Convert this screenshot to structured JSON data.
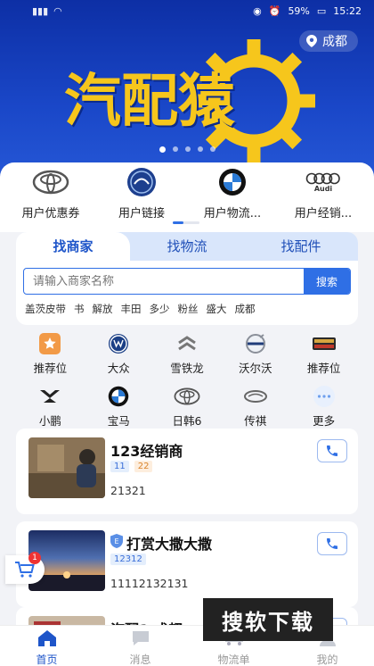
{
  "status_bar": {
    "time": "15:22",
    "battery": "59%"
  },
  "banner": {
    "logo_text": "汽配猿",
    "location": "成都"
  },
  "top_brands": [
    {
      "label": "用户优惠券",
      "icon": "toyota-logo-icon"
    },
    {
      "label": "用户链接",
      "icon": "dongfeng-logo-icon"
    },
    {
      "label": "用户物流...",
      "icon": "bmw-logo-icon"
    },
    {
      "label": "用户经销...",
      "icon": "audi-logo-icon",
      "logo_text": "Audi"
    }
  ],
  "search": {
    "tabs": [
      "找商家",
      "找物流",
      "找配件"
    ],
    "active_tab": 0,
    "placeholder": "请输入商家名称",
    "button": "搜索",
    "hot_tags": [
      "盖茨皮带",
      "书",
      "解放",
      "丰田",
      "多少",
      "粉丝",
      "盛大",
      "成都"
    ]
  },
  "grid": [
    {
      "label": "推荐位",
      "icon": "star-icon"
    },
    {
      "label": "大众",
      "icon": "volkswagen-logo-icon"
    },
    {
      "label": "雪铁龙",
      "icon": "citroen-logo-icon"
    },
    {
      "label": "沃尔沃",
      "icon": "volvo-logo-icon"
    },
    {
      "label": "推荐位",
      "icon": "geely-logo-icon"
    },
    {
      "label": "小鹏",
      "icon": "xpeng-logo-icon"
    },
    {
      "label": "宝马",
      "icon": "bmw-logo-icon"
    },
    {
      "label": "日韩6",
      "icon": "toyota-logo-icon"
    },
    {
      "label": "传祺",
      "icon": "trumpchi-logo-icon"
    },
    {
      "label": "更多",
      "icon": "more-dots-icon"
    }
  ],
  "dealers": [
    {
      "name": "123经销商",
      "tags": [
        "11",
        "22"
      ],
      "phone": "21321",
      "verified": false
    },
    {
      "name": "打赏大撒大撒",
      "tags": [
        "12312"
      ],
      "phone": "11112132131",
      "verified": true
    },
    {
      "name": "汽配1 成都",
      "tags": [],
      "phone": "",
      "verified": false
    }
  ],
  "cart": {
    "badge": "1"
  },
  "watermark": "搜软下载",
  "tabbar": [
    {
      "label": "首页",
      "icon": "home-icon",
      "active": true
    },
    {
      "label": "消息",
      "icon": "message-icon",
      "active": false
    },
    {
      "label": "物流单",
      "icon": "truck-icon",
      "active": false
    },
    {
      "label": "我的",
      "icon": "user-icon",
      "active": false
    }
  ],
  "colors": {
    "primary": "#1e55c9",
    "banner": "#1a47c8",
    "logo_yellow": "#f6c61c"
  }
}
